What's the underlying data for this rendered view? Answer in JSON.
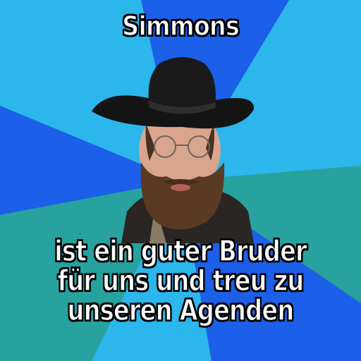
{
  "meme": {
    "top_text": "Simmons",
    "bottom_text": "ist ein guter Bruder für uns und treu zu unseren Agenden"
  },
  "colors": {
    "sky": "#2bb6ec",
    "royal": "#1c5fe9",
    "teal": "#27a29e",
    "caption_fill": "#ffffff",
    "caption_outline": "#000000"
  }
}
